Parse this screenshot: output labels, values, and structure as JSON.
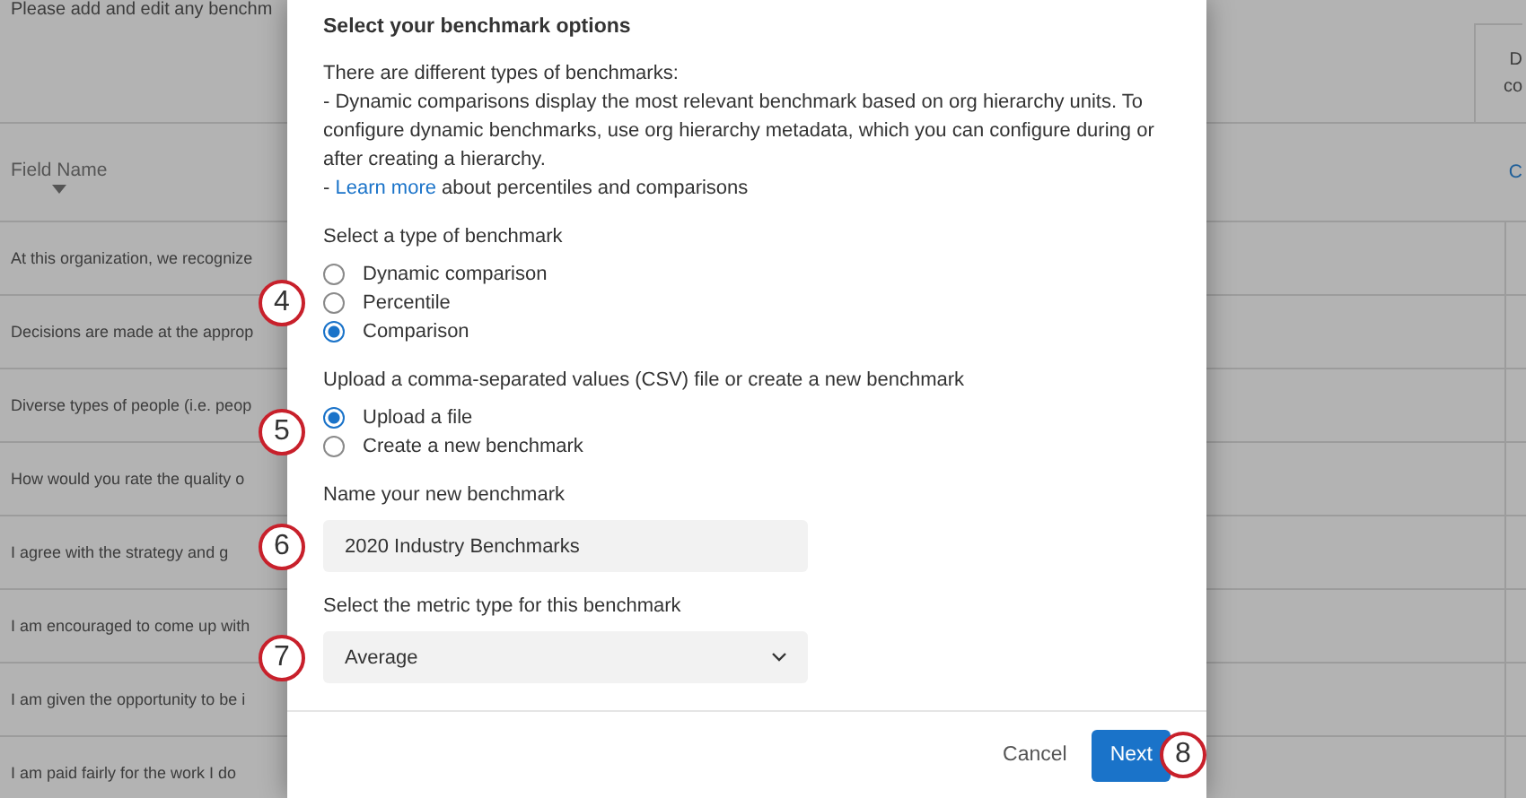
{
  "background_page": {
    "intro_text": "Please add and edit any benchm",
    "header_box_lines": [
      "D",
      "co"
    ],
    "table": {
      "column_header": "Field Name",
      "header_link": "C",
      "rows": [
        "At this organization, we recognize",
        "Decisions are made at the approp",
        "Diverse types of people (i.e. peop",
        "How would you rate the quality o",
        "I agree with the strategy and g",
        "I am encouraged to come up with",
        "I am given the opportunity to be i",
        "I am paid fairly for the work I do"
      ]
    }
  },
  "dialog": {
    "title": "Select your benchmark options",
    "description": {
      "intro": "There are different types of benchmarks:",
      "bullet_1": "- Dynamic comparisons display the most relevant benchmark based on org hierarchy units. To configure dynamic benchmarks, use org hierarchy metadata, which you can configure during or after creating a hierarchy.",
      "bullet_2_prefix": "- ",
      "bullet_2_link": "Learn more",
      "bullet_2_suffix": " about percentiles and comparisons"
    },
    "benchmark_type": {
      "label": "Select a type of benchmark",
      "callout": "4",
      "options": [
        {
          "label": "Dynamic comparison",
          "selected": false
        },
        {
          "label": "Percentile",
          "selected": false
        },
        {
          "label": "Comparison",
          "selected": true
        }
      ]
    },
    "source": {
      "label": "Upload a comma-separated values (CSV) file or create a new benchmark",
      "callout": "5",
      "options": [
        {
          "label": "Upload a file",
          "selected": true
        },
        {
          "label": "Create a new benchmark",
          "selected": false
        }
      ]
    },
    "name_field": {
      "label": "Name your new benchmark",
      "value": "2020 Industry Benchmarks",
      "callout": "6"
    },
    "metric_field": {
      "label": "Select the metric type for this benchmark",
      "value": "Average",
      "callout": "7"
    },
    "buttons": [
      {
        "label": "Cancel",
        "kind": "secondary"
      },
      {
        "label": "Next",
        "kind": "primary",
        "callout": "8"
      }
    ]
  }
}
